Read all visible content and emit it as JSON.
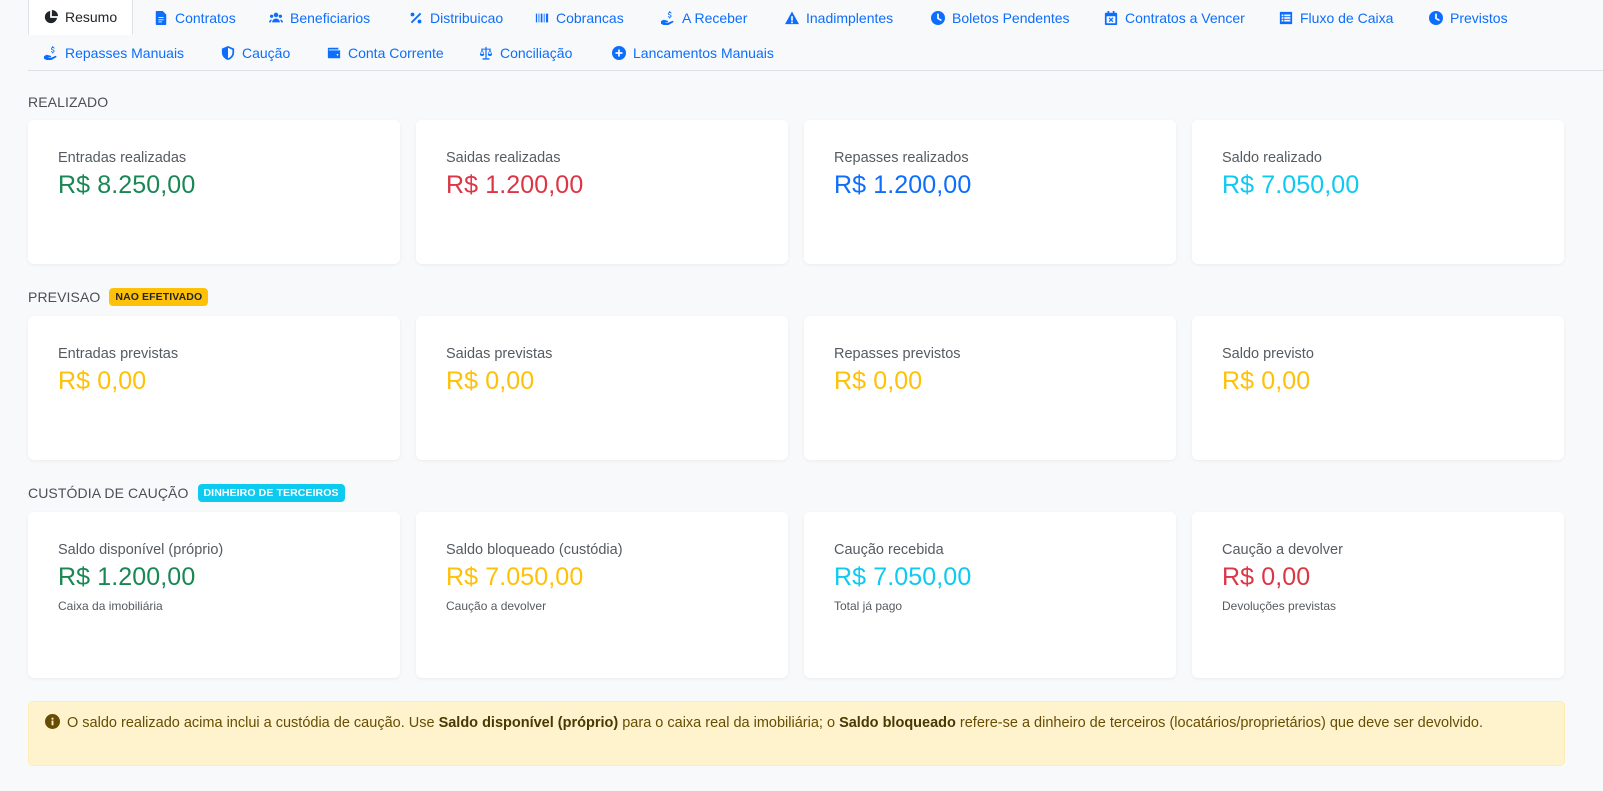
{
  "tabs_row1": [
    {
      "label": "Resumo",
      "icon": "chart-pie-icon",
      "active": true
    },
    {
      "label": "Contratos",
      "icon": "file-contract-icon"
    },
    {
      "label": "Beneficiarios",
      "icon": "users-icon"
    },
    {
      "label": "Distribuicao",
      "icon": "percent-icon"
    },
    {
      "label": "Cobrancas",
      "icon": "barcode-icon"
    },
    {
      "label": "A Receber",
      "icon": "hand-holding-dollar-icon"
    },
    {
      "label": "Inadimplentes",
      "icon": "warning-triangle-icon"
    },
    {
      "label": "Boletos Pendentes",
      "icon": "clock-icon"
    },
    {
      "label": "Contratos a Vencer",
      "icon": "calendar-x-icon"
    },
    {
      "label": "Fluxo de Caixa",
      "icon": "list-alt-icon"
    },
    {
      "label": "Previstos",
      "icon": "clock-icon"
    }
  ],
  "tabs_row2": [
    {
      "label": "Repasses Manuais",
      "icon": "hand-holding-dollar-icon"
    },
    {
      "label": "Caução",
      "icon": "shield-icon"
    },
    {
      "label": "Conta Corrente",
      "icon": "wallet-icon"
    },
    {
      "label": "Conciliação",
      "icon": "scale-balanced-icon"
    },
    {
      "label": "Lancamentos Manuais",
      "icon": "plus-circle-icon"
    }
  ],
  "realizado": {
    "title": "REALIZADO",
    "cards": [
      {
        "label": "Entradas realizadas",
        "value": "R$ 8.250,00",
        "color": "#198754"
      },
      {
        "label": "Saidas realizadas",
        "value": "R$ 1.200,00",
        "color": "#dc3545"
      },
      {
        "label": "Repasses realizados",
        "value": "R$ 1.200,00",
        "color": "#0d6efd"
      },
      {
        "label": "Saldo realizado",
        "value": "R$ 7.050,00",
        "color": "#0dcaf0"
      }
    ]
  },
  "previsao": {
    "title": "PREVISAO",
    "badge": "NAO EFETIVADO",
    "cards": [
      {
        "label": "Entradas previstas",
        "value": "R$ 0,00",
        "color": "#ffc107"
      },
      {
        "label": "Saidas previstas",
        "value": "R$ 0,00",
        "color": "#ffc107"
      },
      {
        "label": "Repasses previstos",
        "value": "R$ 0,00",
        "color": "#ffc107"
      },
      {
        "label": "Saldo previsto",
        "value": "R$ 0,00",
        "color": "#ffc107"
      }
    ]
  },
  "custodia": {
    "title": "CUSTÓDIA DE CAUÇÃO",
    "badge": "DINHEIRO DE TERCEIROS",
    "cards": [
      {
        "label": "Saldo disponível (próprio)",
        "value": "R$ 1.200,00",
        "sub": "Caixa da imobiliária",
        "color": "#198754"
      },
      {
        "label": "Saldo bloqueado (custódia)",
        "value": "R$ 7.050,00",
        "sub": "Caução a devolver",
        "color": "#ffc107"
      },
      {
        "label": "Caução recebida",
        "value": "R$ 7.050,00",
        "sub": "Total já pago",
        "color": "#0dcaf0"
      },
      {
        "label": "Caução a devolver",
        "value": "R$ 0,00",
        "sub": "Devoluções previstas",
        "color": "#dc3545"
      }
    ]
  },
  "alert": {
    "icon": "info-circle-icon",
    "text_1": "O saldo realizado acima inclui a custódia de caução. Use ",
    "bold_1": "Saldo disponível (próprio)",
    "text_2": " para o caixa real da imobiliária; o ",
    "bold_2": "Saldo bloqueado",
    "text_3": " refere-se a dinheiro de terceiros (locatários/proprietários) que deve ser devolvido."
  }
}
